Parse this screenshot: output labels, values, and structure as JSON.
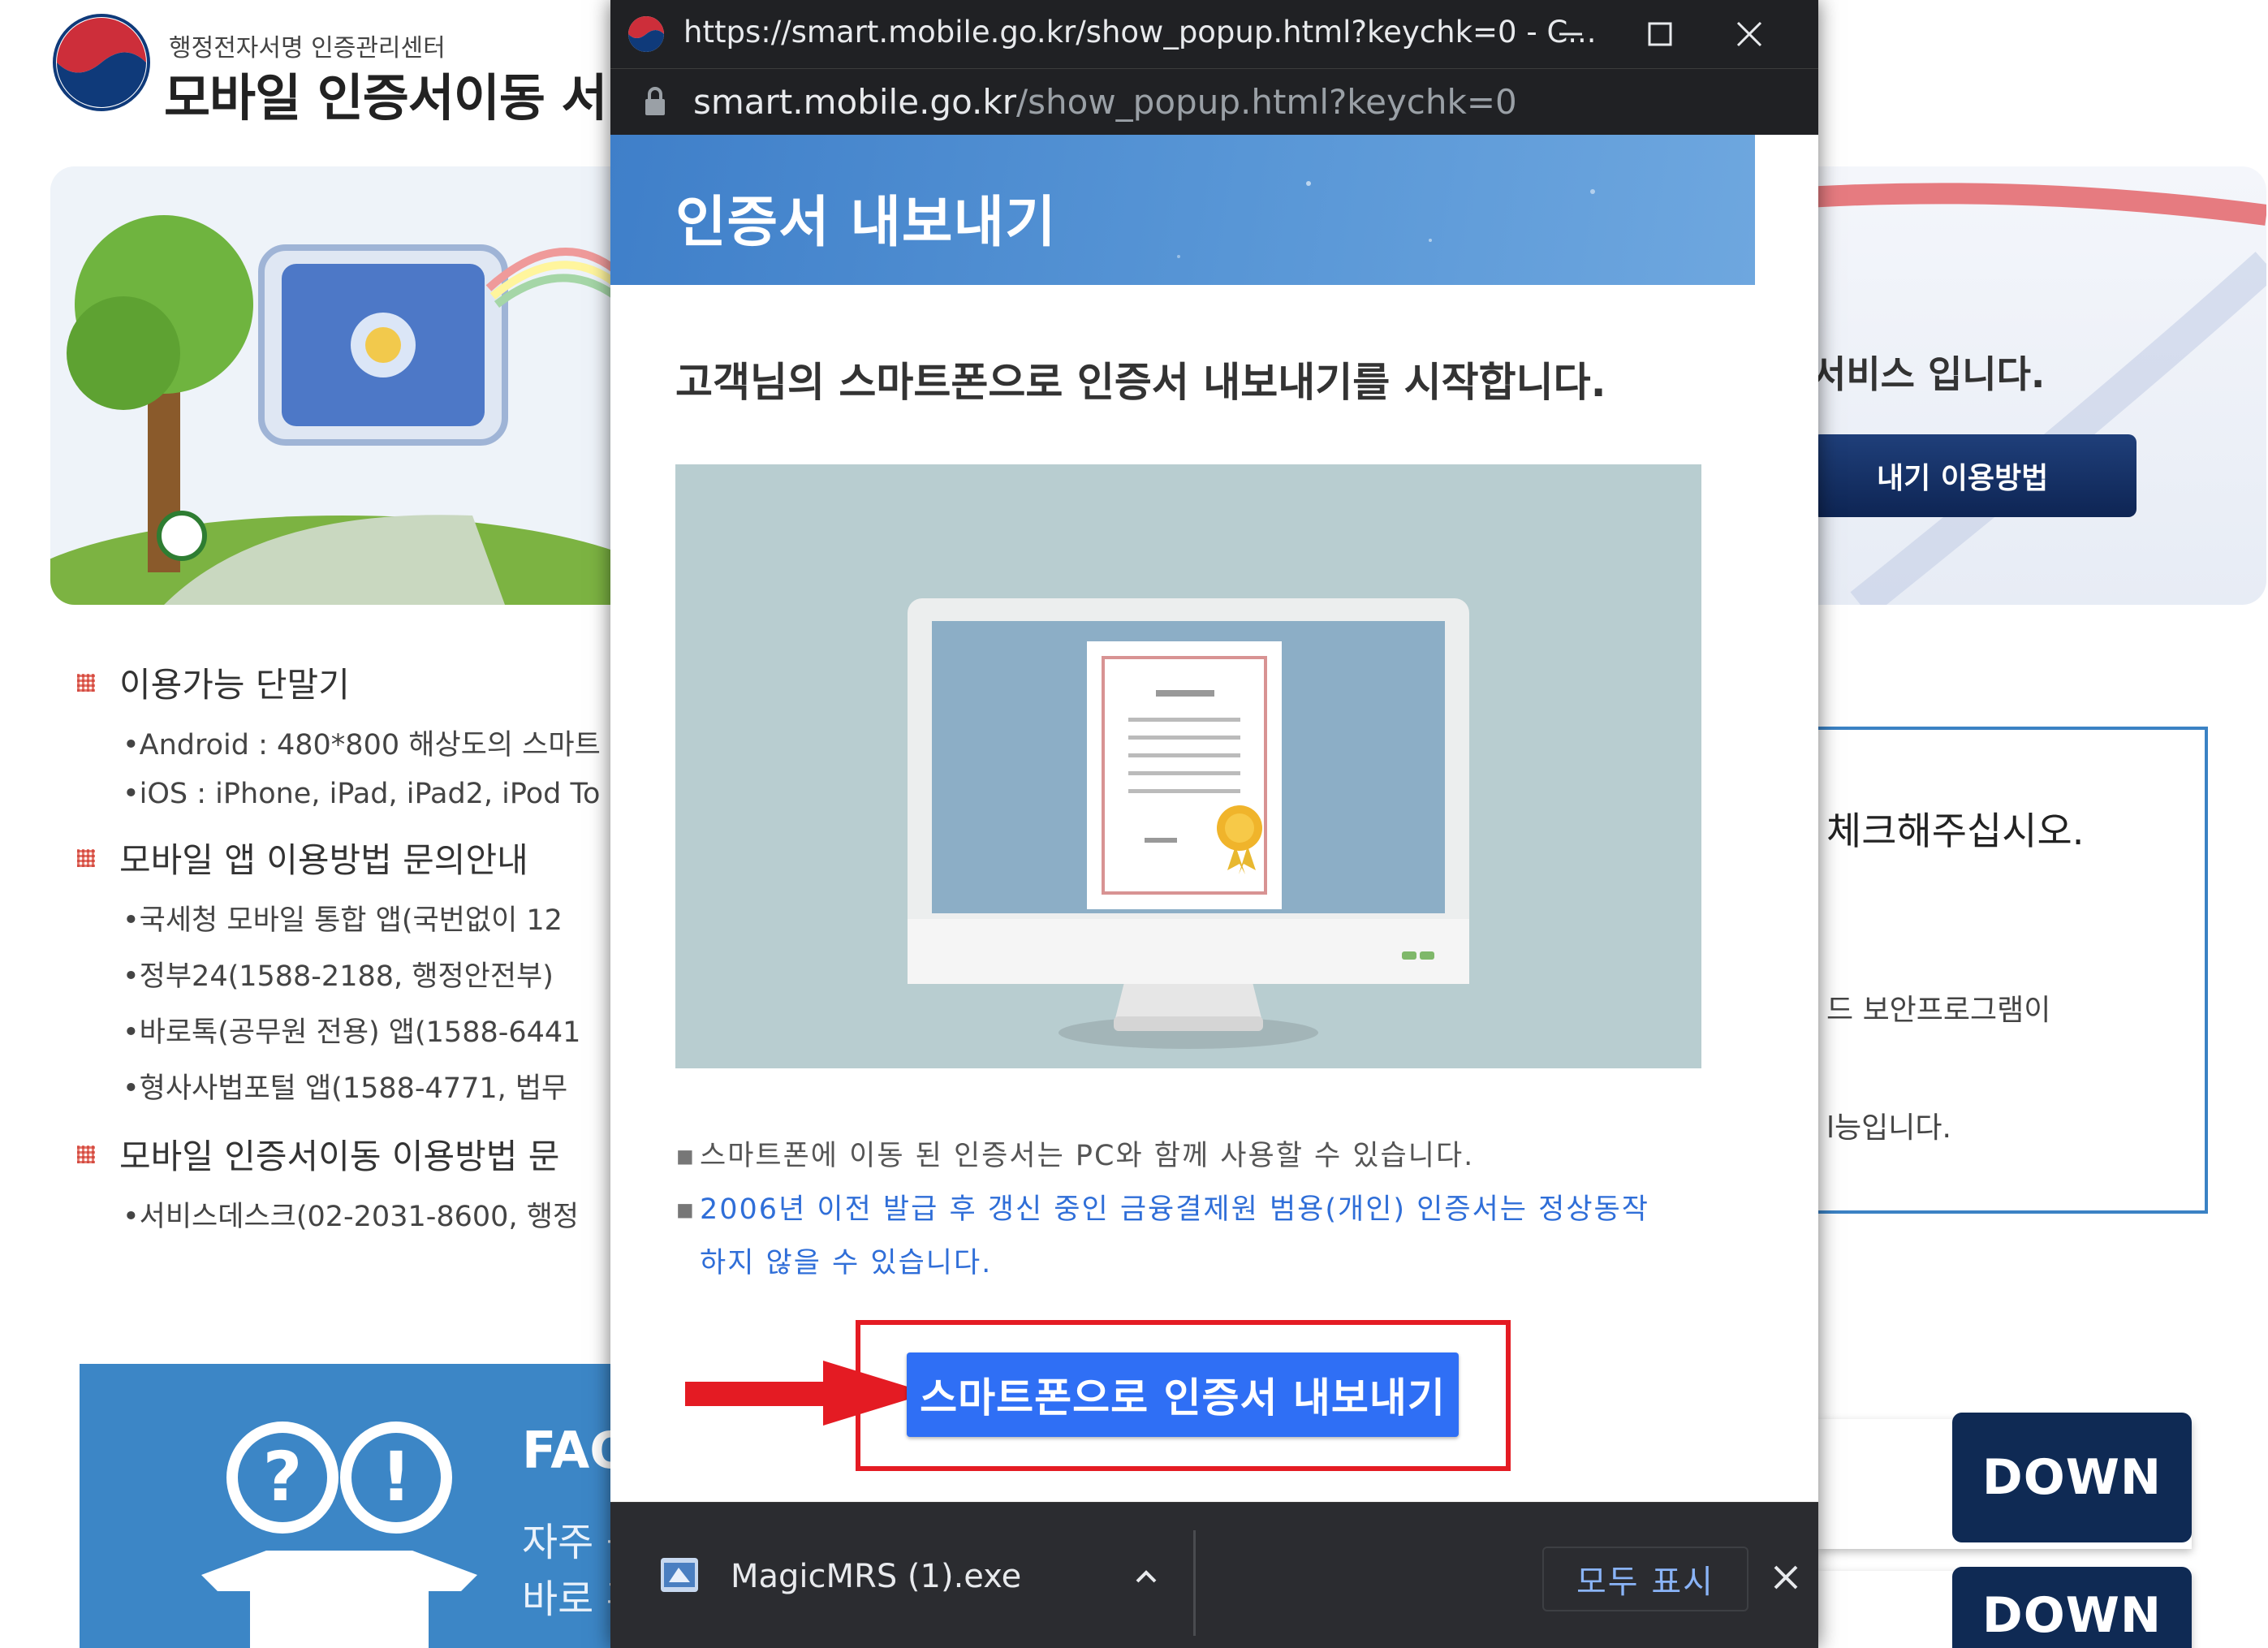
{
  "background": {
    "brand": {
      "subtitle": "행정전자서명 인증관리센터",
      "title": "모바일 인증서이동 서비"
    },
    "hero": {
      "text": "서비스 입니다.",
      "button_label": "내기 이용방법"
    },
    "info": {
      "devices_title": "이용가능 단말기",
      "devices": [
        "•Android : 480*800 해상도의 스마트",
        "•iOS : iPhone, iPad, iPad2, iPod To"
      ],
      "app_title": "모바일 앱 이용방법 문의안내",
      "apps": [
        "•국세청 모바일 통합 앱(국번없이 12",
        "•정부24(1588-2188, 행정안전부)",
        "•바로톡(공무원 전용) 앱(1588-6441",
        "•형사사법포털 앱(1588-4771, 법무"
      ],
      "usage_title": "모바일 인증서이동 이용방법 문",
      "usage": [
        "•서비스데스크(02-2031-8600, 행정"
      ]
    },
    "notice": {
      "line1": "체크해주십시오.",
      "line2": "드 보안프로그램이",
      "line3": "l능입니다."
    },
    "faq": {
      "title": "FAQ",
      "sub1": "자주 등",
      "sub2": "바로 혹"
    },
    "down_label": "DOWN",
    "colors": {
      "brand_blue": "#3c86c6",
      "down_navy": "#0f2a54"
    }
  },
  "popup": {
    "window_title": "https://smart.mobile.go.kr/show_popup.html?keychk=0 - C...",
    "url_host": "smart.mobile.go.kr",
    "url_path": "/show_popup.html?keychk=0",
    "banner_title": "인증서 내보내기",
    "lead": "고객님의 스마트폰으로 인증서 내보내기를 시작합니다.",
    "notes": [
      {
        "text": "스마트폰에 이동 된 인증서는 PC와 함께 사용할 수 있습니다.",
        "color": "gray"
      },
      {
        "text_line1": "2006년 이전 발급 후 갱신 중인 금융결제원 범용(개인) 인증서는 정상동작",
        "text_line2": "하지 않을 수 있습니다.",
        "color": "blue"
      }
    ],
    "export_button": "스마트폰으로 인증서 내보내기",
    "bullet": "▪",
    "colors": {
      "button": "#2f6ff5",
      "highlight": "#e41b23",
      "banner": "#4a88cf"
    }
  },
  "download_bar": {
    "file_name": "MagicMRS (1).exe",
    "show_all": "모두 표시"
  },
  "icons": [
    "gov-logo-icon",
    "window-favicon-icon",
    "minimize-icon",
    "maximize-icon",
    "close-icon",
    "lock-icon",
    "certificate-monitor-illustration",
    "red-arrow-icon",
    "installer-file-icon",
    "chevron-up-icon",
    "close-download-bar-icon"
  ]
}
